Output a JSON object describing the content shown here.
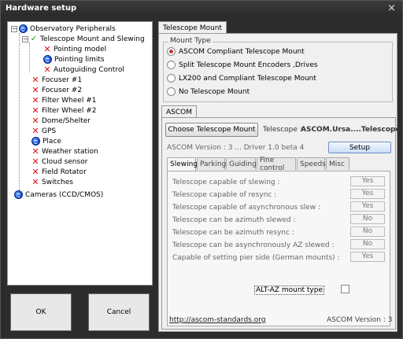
{
  "window": {
    "title": "Hardware setup",
    "close_symbol": "×"
  },
  "tree": {
    "root": {
      "label": "Observatory Peripherals",
      "expander": "−"
    },
    "mount": {
      "label": "Telescope Mount and Slewing",
      "expander": "−"
    },
    "mount_children": [
      {
        "label": "Pointing model",
        "status": "x"
      },
      {
        "label": "Pointing limits",
        "status": "globe"
      },
      {
        "label": "Autoguiding Control",
        "status": "x"
      }
    ],
    "items": [
      {
        "label": "Focuser #1",
        "status": "x"
      },
      {
        "label": "Focuser #2",
        "status": "x"
      },
      {
        "label": "Filter Wheel #1",
        "status": "x"
      },
      {
        "label": "Filter Wheel #2",
        "status": "x"
      },
      {
        "label": "Dome/Shelter",
        "status": "x"
      },
      {
        "label": "GPS",
        "status": "x"
      },
      {
        "label": "Place",
        "status": "globe"
      },
      {
        "label": "Weather station",
        "status": "x"
      },
      {
        "label": "Cloud sensor",
        "status": "x"
      },
      {
        "label": "Field Rotator",
        "status": "x"
      },
      {
        "label": "Switches",
        "status": "x"
      }
    ],
    "cameras": {
      "label": "Cameras (CCD/CMOS)"
    }
  },
  "buttons": {
    "ok": "OK",
    "cancel": "Cancel"
  },
  "right": {
    "main_tab": "Telescope Mount",
    "mount_type": {
      "legend": "Mount Type",
      "options": [
        {
          "label": "ASCOM Compliant Telescope Mount",
          "selected": true
        },
        {
          "label": "Split Telescope  Mount Encoders ,Drives",
          "selected": false
        },
        {
          "label": "LX200 and Compliant Telescope Mount",
          "selected": false
        },
        {
          "label": "No Telescope Mount",
          "selected": false
        }
      ]
    },
    "ascom_tab": "ASCOM",
    "choose_button": "Choose Telescope Mount",
    "telescope_prefix": "Telescope :",
    "telescope_name": "ASCOM.Ursa....Telescope",
    "version_line": "ASCOM Version : 3 ... Driver 1.0 beta 4",
    "setup_button": "Setup",
    "subtabs": [
      "Slewing",
      "Parking",
      "Guiding",
      "Fine control",
      "Speeds",
      "Misc"
    ],
    "active_subtab": "Slewing",
    "capabilities": [
      {
        "label": "Telescope capable of slewing :",
        "value": "Yes"
      },
      {
        "label": "Telescope capable of resync :",
        "value": "Yes"
      },
      {
        "label": "Telescope capable of asynchronous slew :",
        "value": "Yes"
      },
      {
        "label": "Telescope can be azimuth slewed :",
        "value": "No"
      },
      {
        "label": "Telescope can be azimuth resync :",
        "value": "No"
      },
      {
        "label": "Telescope can be asynchronously AZ slewed :",
        "value": "No"
      },
      {
        "label": "Capable of setting pier side (German mounts) :",
        "value": "Yes"
      }
    ],
    "altaz_label": "ALT-AZ mount type",
    "altaz_checked": false,
    "footer_link": "http://ascom-standards.org",
    "footer_version": "ASCOM Version : 3"
  },
  "colors": {
    "error_x": "#e01010",
    "check": "#1a9a1a",
    "globe": "#0a3cc8",
    "selected_radio": "#c0392b"
  }
}
